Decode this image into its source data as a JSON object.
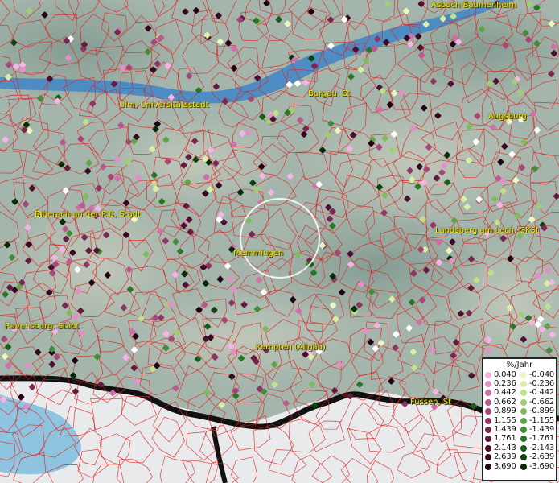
{
  "cities": [
    {
      "name": "Asbach-Bäumenheim"
    },
    {
      "name": "Ulm, Universitätsstadt"
    },
    {
      "name": "Burgau, St"
    },
    {
      "name": "Augsburg"
    },
    {
      "name": "Biberach an der Riß, Stadt"
    },
    {
      "name": "Landsberg am Lech, GKSt"
    },
    {
      "name": "Memmingen"
    },
    {
      "name": "Ravensburg, Stadt"
    },
    {
      "name": "Kempten (Allgäu)"
    },
    {
      "name": "Füssen, St"
    }
  ],
  "legend": {
    "title": "%/Jahr",
    "positive": [
      {
        "label": "0.040",
        "color": "#f6b3e6"
      },
      {
        "label": "0.236",
        "color": "#e58fc9"
      },
      {
        "label": "0.442",
        "color": "#d06fa8"
      },
      {
        "label": "0.662",
        "color": "#b9598f"
      },
      {
        "label": "0.899",
        "color": "#a54778"
      },
      {
        "label": "1.155",
        "color": "#8e3663"
      },
      {
        "label": "1.439",
        "color": "#782750"
      },
      {
        "label": "1.761",
        "color": "#631b3f"
      },
      {
        "label": "2.143",
        "color": "#4d1030"
      },
      {
        "label": "2.639",
        "color": "#360822"
      },
      {
        "label": "3.690",
        "color": "#220315"
      }
    ],
    "negative": [
      {
        "label": "-0.040",
        "color": "#eef7c0"
      },
      {
        "label": "-0.236",
        "color": "#d8efa6"
      },
      {
        "label": "-0.442",
        "color": "#bfe18c"
      },
      {
        "label": "-0.662",
        "color": "#9fcf72"
      },
      {
        "label": "-0.899",
        "color": "#7fbb5c"
      },
      {
        "label": "-1.155",
        "color": "#5fa548"
      },
      {
        "label": "-1.439",
        "color": "#418e36"
      },
      {
        "label": "-1.761",
        "color": "#2a7627"
      },
      {
        "label": "-2.143",
        "color": "#175e1a"
      },
      {
        "label": "-2.639",
        "color": "#0a4510"
      },
      {
        "label": "-3.690",
        "color": "#032c08"
      }
    ]
  },
  "colors": {
    "boundary": "#e02020",
    "river": "#3f86c8",
    "lake": "#8ec4e0",
    "alps": "#e6e8ea",
    "border": "#111111",
    "label": "#f2e600"
  }
}
